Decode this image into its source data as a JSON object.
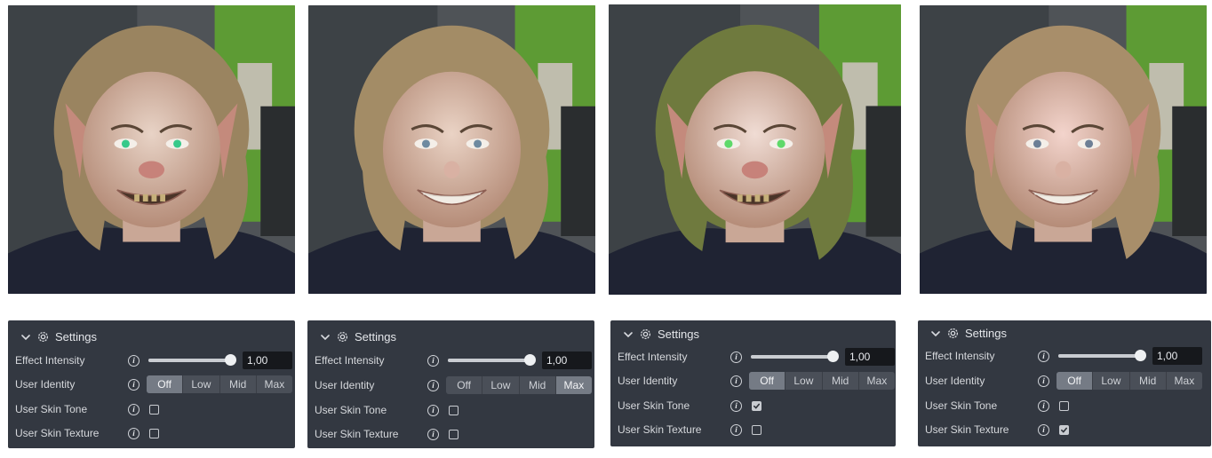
{
  "panels": [
    {
      "title": "Settings",
      "rows": {
        "effect_intensity": {
          "label": "Effect Intensity",
          "value": "1,00",
          "level": 1.0
        },
        "user_identity": {
          "label": "User Identity",
          "options": [
            "Off",
            "Low",
            "Mid",
            "Max"
          ],
          "selected": "Off"
        },
        "user_skin_tone": {
          "label": "User Skin Tone",
          "checked": false
        },
        "user_skin_texture": {
          "label": "User Skin Texture",
          "checked": false
        }
      }
    },
    {
      "title": "Settings",
      "rows": {
        "effect_intensity": {
          "label": "Effect Intensity",
          "value": "1,00",
          "level": 1.0
        },
        "user_identity": {
          "label": "User Identity",
          "options": [
            "Off",
            "Low",
            "Mid",
            "Max"
          ],
          "selected": "Max"
        },
        "user_skin_tone": {
          "label": "User Skin Tone",
          "checked": false
        },
        "user_skin_texture": {
          "label": "User Skin Texture",
          "checked": false
        }
      }
    },
    {
      "title": "Settings",
      "rows": {
        "effect_intensity": {
          "label": "Effect Intensity",
          "value": "1,00",
          "level": 1.0
        },
        "user_identity": {
          "label": "User Identity",
          "options": [
            "Off",
            "Low",
            "Mid",
            "Max"
          ],
          "selected": "Off"
        },
        "user_skin_tone": {
          "label": "User Skin Tone",
          "checked": true
        },
        "user_skin_texture": {
          "label": "User Skin Texture",
          "checked": false
        }
      }
    },
    {
      "title": "Settings",
      "rows": {
        "effect_intensity": {
          "label": "Effect Intensity",
          "value": "1,00",
          "level": 1.0
        },
        "user_identity": {
          "label": "User Identity",
          "options": [
            "Off",
            "Low",
            "Mid",
            "Max"
          ],
          "selected": "Off"
        },
        "user_skin_tone": {
          "label": "User Skin Tone",
          "checked": false
        },
        "user_skin_texture": {
          "label": "User Skin Texture",
          "checked": true
        }
      }
    }
  ],
  "info_glyph": "i",
  "colors": {
    "panel_bg": "#333841",
    "segment_selected": "#757b85",
    "numbox_bg": "#16181c"
  }
}
